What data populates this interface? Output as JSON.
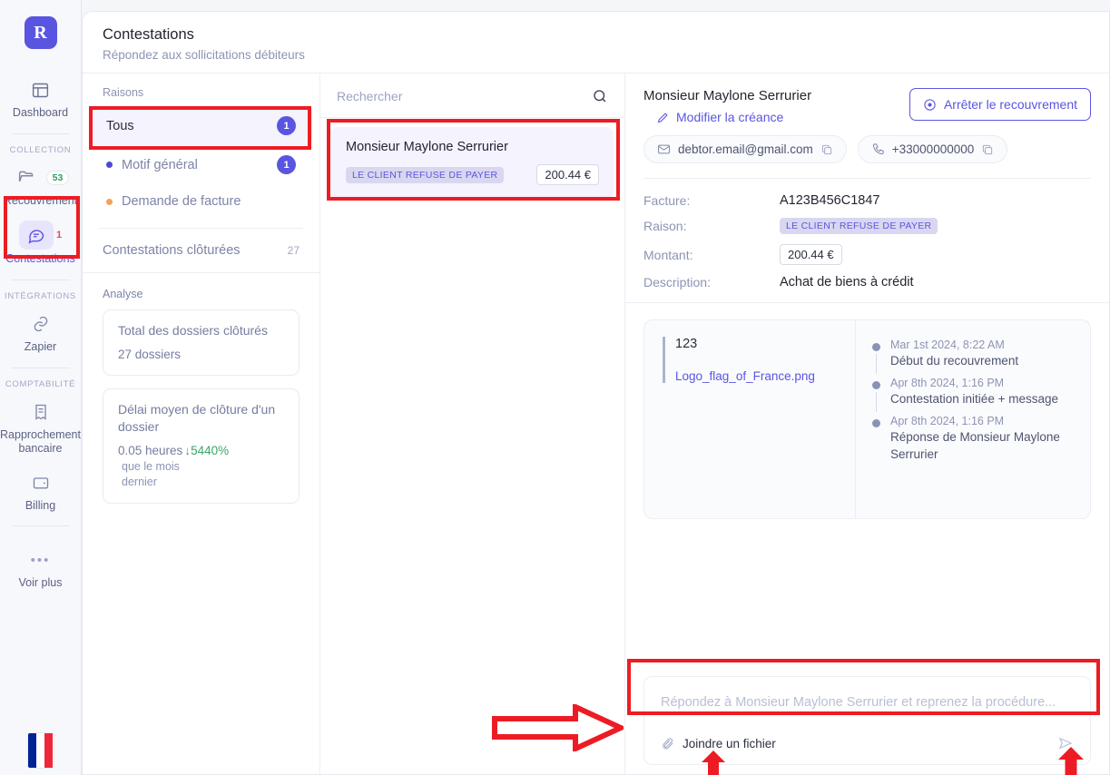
{
  "sidebar": {
    "logo_letter": "R",
    "items": [
      {
        "label": "Dashboard",
        "icon": "layout-icon"
      },
      {
        "label": "Recouvrement",
        "icon": "folder-icon",
        "badge": "53"
      },
      {
        "label": "Contestations",
        "icon": "chat-bubble-icon",
        "badge": "1",
        "active": true
      },
      {
        "label": "Zapier",
        "icon": "link-icon"
      },
      {
        "label": "Rapprochement bancaire",
        "icon": "receipt-icon"
      },
      {
        "label": "Billing",
        "icon": "wallet-icon"
      },
      {
        "label": "Voir plus",
        "icon": "ellipsis-icon"
      }
    ],
    "sections": {
      "collection": "COLLECTION",
      "integrations": "INTÉGRATIONS",
      "comptabilite": "COMPTABILITÉ"
    },
    "flag": {
      "name": "france-flag",
      "colors": [
        "#002395",
        "#ffffff",
        "#ed2939"
      ]
    }
  },
  "header": {
    "title": "Contestations",
    "subtitle": "Répondez aux sollicitations débiteurs"
  },
  "reasons": {
    "heading": "Raisons",
    "items": [
      {
        "label": "Tous",
        "count": "1",
        "dot": null,
        "selected": true
      },
      {
        "label": "Motif général",
        "count": "1",
        "dot": "#4f46d8",
        "selected": false
      },
      {
        "label": "Demande de facture",
        "count": "",
        "dot": "#f5a05a",
        "selected": false
      }
    ],
    "closed": {
      "label": "Contestations clôturées",
      "count": "27"
    },
    "analysis_heading": "Analyse",
    "stats": [
      {
        "title": "Total des dossiers clôturés",
        "value": "27 dossiers"
      },
      {
        "title": "Délai moyen de clôture d'un dossier",
        "value": "0.05 heures",
        "delta": "↓5440%",
        "delta_sub": "que le mois dernier"
      }
    ]
  },
  "list": {
    "search_placeholder": "Rechercher",
    "search_value": "",
    "cards": [
      {
        "name": "Monsieur Maylone Serrurier",
        "tag": "LE CLIENT REFUSE DE PAYER",
        "amount": "200.44 €"
      }
    ]
  },
  "detail": {
    "debtor_name": "Monsieur Maylone Serrurier",
    "edit_link": "Modifier la créance",
    "stop_button": "Arrêter le recouvrement",
    "email": "debtor.email@gmail.com",
    "phone": "+33000000000",
    "facts": [
      {
        "key": "Facture:",
        "value": "A123B456C1847",
        "type": "text"
      },
      {
        "key": "Raison:",
        "value": "LE CLIENT REFUSE DE PAYER",
        "type": "tag"
      },
      {
        "key": "Montant:",
        "value": "200.44 €",
        "type": "box"
      },
      {
        "key": "Description:",
        "value": "Achat de biens à crédit",
        "type": "text"
      }
    ],
    "message": {
      "text": "123",
      "file": "Logo_flag_of_France.png"
    },
    "timeline": [
      {
        "date": "Mar 1st 2024, 8:22 AM",
        "text": "Début du recouvrement"
      },
      {
        "date": "Apr 8th 2024, 1:16 PM",
        "text": "Contestation initiée + message"
      },
      {
        "date": "Apr 8th 2024, 1:16 PM",
        "text": "Réponse de Monsieur Maylone Serrurier"
      }
    ],
    "reply": {
      "placeholder": "Répondez à Monsieur Maylone Serrurier et reprenez la procédure...",
      "value": "",
      "attach_label": "Joindre un fichier"
    }
  },
  "annotations": {
    "color": "#ed1c24"
  }
}
